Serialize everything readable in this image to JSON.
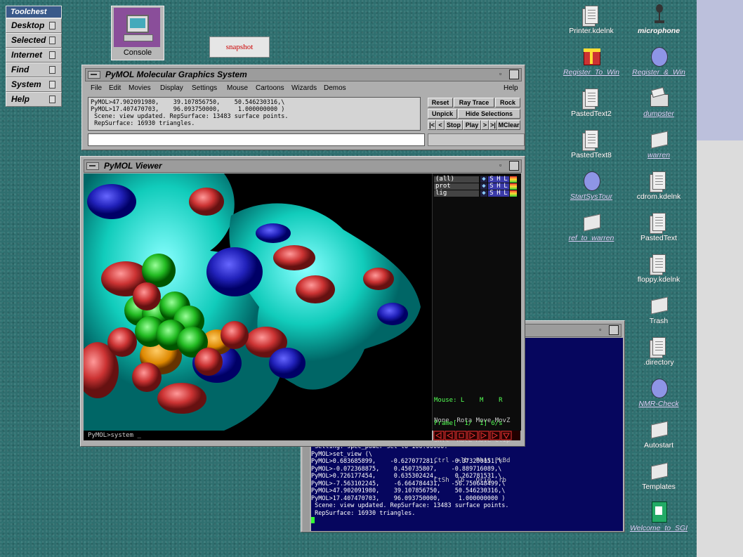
{
  "toolchest": {
    "title": "Toolchest",
    "items": [
      "Desktop",
      "Selected",
      "Internet",
      "Find",
      "System",
      "Help"
    ]
  },
  "console_label": "Console",
  "snapshot_label": "snapshot",
  "pymol": {
    "title": "PyMOL Molecular Graphics System",
    "menu": [
      "File",
      "Edit",
      "Movies",
      "Display",
      "Settings",
      "Mouse",
      "Cartoons",
      "Wizards",
      "Demos"
    ],
    "help": "Help",
    "log": [
      "PyMOL>47.902091980,    39.107856750,    50.546230316,\\",
      "PyMOL>17.407470703,    96.093750000,     1.000000000 )",
      " Scene: view updated. RepSurface: 13483 surface points.",
      " RepSurface: 16930 triangles."
    ],
    "buttons": [
      "Reset",
      "Ray Trace",
      "Rock",
      "Unpick",
      "Hide Selections",
      "|<",
      "<",
      "Stop",
      "Play",
      ">",
      ">|",
      "MClear"
    ]
  },
  "viewer": {
    "title": "PyMOL Viewer",
    "objects": [
      "(all)",
      "prot",
      "lig"
    ],
    "obj_buttons": [
      "S",
      "H",
      "L"
    ],
    "mouse": [
      "Mouse: L    M    R",
      "None  Rota Move MovZ",
      "Shft  RotZ Move Clip",
      "Ctrl  +lb  PkAt PkBd",
      "CtSh  lb   Orig  rb"
    ],
    "frame": "Frame[  1/  1] 6/s",
    "cmdline": "PyMOL>system _"
  },
  "terminal": {
    "lines": [
      " Setting: spec_power set to 100.00000.",
      "PyMOL>set_view (\\",
      "PyMOL>0.683685899,    -0.627077281,    -0.373290151,\\",
      "PyMOL>-0.072368875,    0.450735807,    -0.889716089,\\",
      "PyMOL>0.726177454,     0.635302424,     0.262781531,\\",
      "PyMOL>-7.563102245,    -6.664784431,   -56.750648499,\\",
      "PyMOL>47.902091980,    39.107856750,    50.546230316,\\",
      "PyMOL>17.407470703,    96.093750000,     1.000000000 )",
      " Scene: view updated. RepSurface: 13483 surface points.",
      " RepSurface: 16930 triangles."
    ]
  },
  "desktop_icons": [
    {
      "label": "Printer.kdelnk",
      "kind": "doc"
    },
    {
      "label": "microphone",
      "kind": "mic"
    },
    {
      "label": "Register_To_Win",
      "kind": "box"
    },
    {
      "label": "Register_&_Win",
      "kind": "disc"
    },
    {
      "label": "PastedText2",
      "kind": "doc"
    },
    {
      "label": "dumpster",
      "kind": "dump"
    },
    {
      "label": "PastedText8",
      "kind": "doc"
    },
    {
      "label": "warren",
      "kind": "folder"
    },
    {
      "label": "StartSysTour",
      "kind": "disc"
    },
    {
      "label": "cdrom.kdelnk",
      "kind": "doc"
    },
    {
      "label": "ref_to_warren",
      "kind": "folder"
    },
    {
      "label": "PastedText",
      "kind": "doc"
    },
    {
      "label": "floppy.kdelnk",
      "kind": "doc"
    },
    {
      "label": "Trash",
      "kind": "folder"
    },
    {
      "label": ".directory",
      "kind": "doc"
    },
    {
      "label": "NMR-Check",
      "kind": "disc"
    },
    {
      "label": "Autostart",
      "kind": "folder"
    },
    {
      "label": "Templates",
      "kind": "folder"
    },
    {
      "label": "Welcome_to_SGI",
      "kind": "sgi"
    }
  ]
}
